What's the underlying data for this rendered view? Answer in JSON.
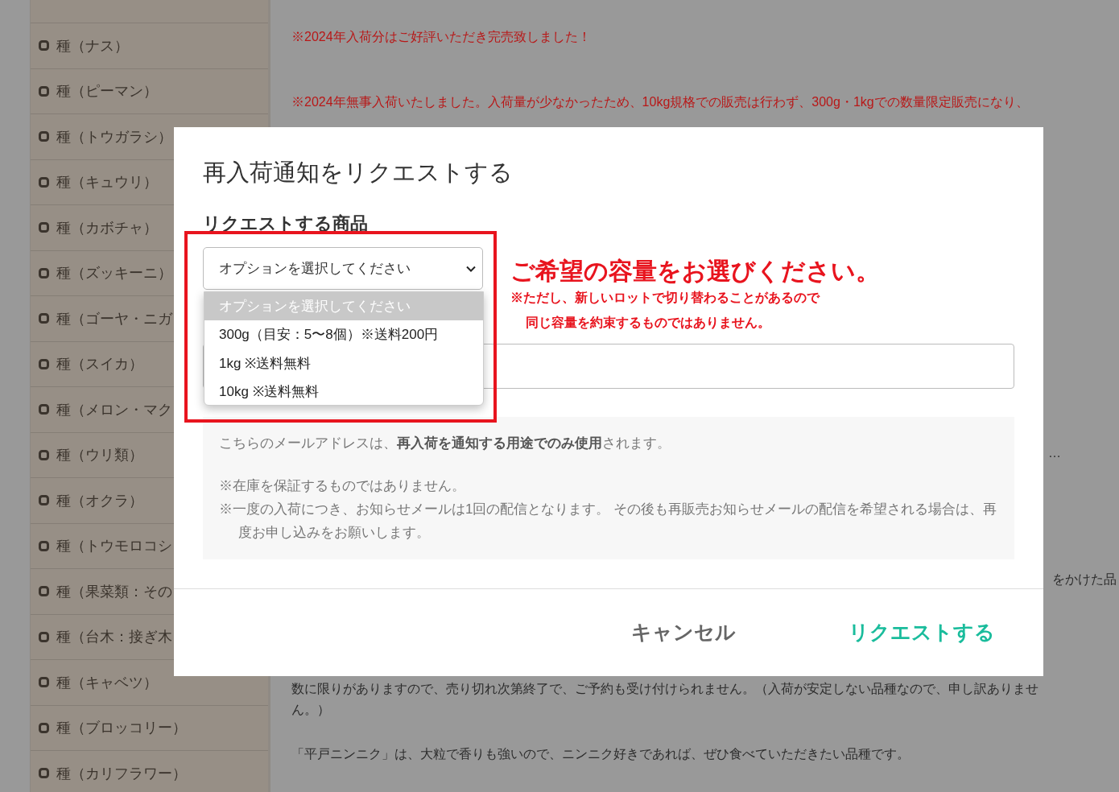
{
  "sidebar": {
    "items": [
      {
        "label": "種（ナス）"
      },
      {
        "label": "種（ピーマン）"
      },
      {
        "label": "種（トウガラシ）"
      },
      {
        "label": "種（キュウリ）"
      },
      {
        "label": "種（カボチャ）"
      },
      {
        "label": "種（ズッキーニ）"
      },
      {
        "label": "種（ゴーヤ・ニガ"
      },
      {
        "label": "種（スイカ）"
      },
      {
        "label": "種（メロン・マク"
      },
      {
        "label": "種（ウリ類）"
      },
      {
        "label": "種（オクラ）"
      },
      {
        "label": "種（トウモロコシ"
      },
      {
        "label": "種（果菜類：その"
      },
      {
        "label": "種（台木：接ぎ木"
      },
      {
        "label": "種（キャベツ）"
      },
      {
        "label": "種（ブロッコリー）"
      },
      {
        "label": "種（カリフラワー）"
      }
    ]
  },
  "content": {
    "notices": [
      "※2024年入荷分はご好評いただき完売致しました！",
      "※2024年無事入荷いたしました。入荷量が少なかったため、10kg規格での販売は行わず、300g・1kgでの数量限定販売になり、"
    ],
    "ellipsis": "…",
    "side_fragment": "をかけた品",
    "paragraphs": [
      "数に限りがありますので、売り切れ次第終了で、ご予約も受け付けられません。（入荷が安定しない品種なので、申し訳ありませ",
      "ん。）",
      "「平戸ニンニク」は、大粒で香りも強いので、ニンニク好きであれば、ぜひ食べていただきたい品種です。"
    ]
  },
  "modal": {
    "title": "再入荷通知をリクエストする",
    "product": {
      "heading": "リクエストする商品",
      "select_value": "オプションを選択してください",
      "options": [
        {
          "label": "オプションを選択してください",
          "selected": true
        },
        {
          "label": "300g（目安：5〜8個）※送料200円",
          "selected": false
        },
        {
          "label": "1kg ※送料無料",
          "selected": false
        },
        {
          "label": "10kg ※送料無料",
          "selected": false
        }
      ]
    },
    "note": {
      "headline": "ご希望の容量をお選びください。",
      "lines": [
        "※ただし、新しいロットで切り替わることがあるので",
        "同じ容量を約束するものではありません。"
      ]
    },
    "info": {
      "lead": "こちらのメールアドレスは、**再入荷を通知する用途でのみ使用**されます。",
      "notes": [
        "※在庫を保証するものではありません。",
        "※一度の入荷につき、お知らせメールは1回の配信となります。 その後も再販売お知らせメールの配信を希望される場合は、再度お申し込みをお願いします。"
      ]
    },
    "buttons": {
      "cancel": "キャンセル",
      "submit": "リクエストする"
    }
  }
}
